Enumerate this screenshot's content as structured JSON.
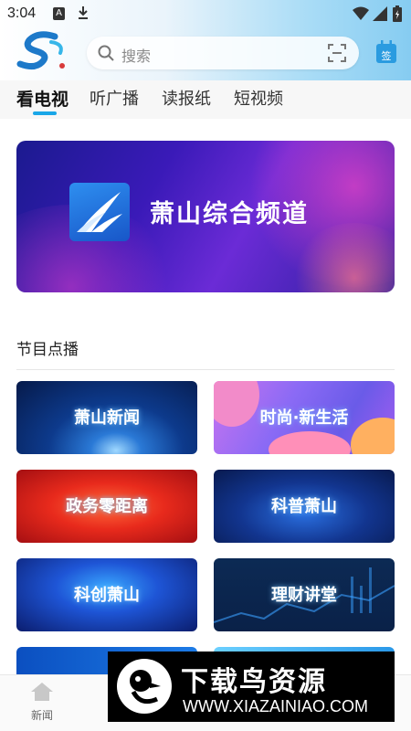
{
  "status_bar": {
    "time": "3:04",
    "a_icon": "A"
  },
  "header": {
    "search_placeholder": "搜索",
    "signin_label": "签"
  },
  "tabs": [
    {
      "label": "看电视",
      "active": true
    },
    {
      "label": "听广播",
      "active": false
    },
    {
      "label": "读报纸",
      "active": false
    },
    {
      "label": "短视频",
      "active": false
    }
  ],
  "banner": {
    "title": "萧山综合频道"
  },
  "section": {
    "title": "节目点播",
    "programs": [
      {
        "label": "萧山新闻"
      },
      {
        "label": "时尚·新生活"
      },
      {
        "label": "政务零距离"
      },
      {
        "label": "科普萧山"
      },
      {
        "label": "科创萧山"
      },
      {
        "label": "理财讲堂"
      }
    ]
  },
  "bottom_nav": {
    "items": [
      {
        "label": "新闻",
        "icon": "home-icon"
      }
    ]
  },
  "watermark": {
    "brand": "下载鸟资源",
    "url": "WWW.XIAZAINIAO.COM"
  },
  "colors": {
    "accent": "#1aa7e8",
    "header_end": "#86ccf1"
  }
}
